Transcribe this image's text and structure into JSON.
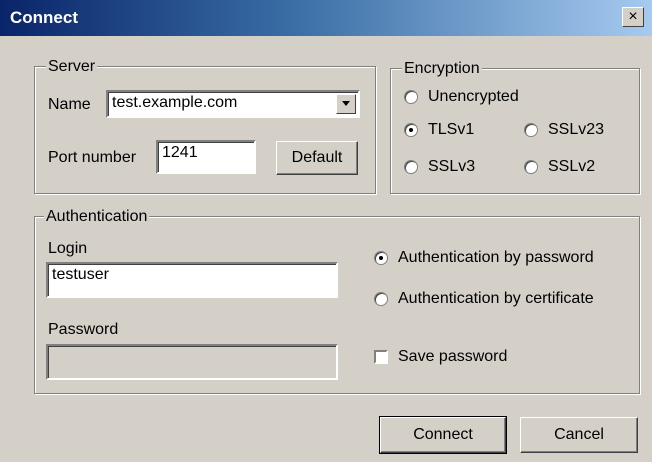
{
  "window": {
    "title": "Connect",
    "close_glyph": "×"
  },
  "server": {
    "legend": "Server",
    "name_label": "Name",
    "name_value": "test.example.com",
    "port_label": "Port number",
    "port_value": "1241",
    "default_button": "Default"
  },
  "encryption": {
    "legend": "Encryption",
    "options": [
      "Unencrypted",
      "TLSv1",
      "SSLv23",
      "SSLv3",
      "SSLv2"
    ],
    "selected": "TLSv1"
  },
  "authentication": {
    "legend": "Authentication",
    "login_label": "Login",
    "login_value": "testuser",
    "password_label": "Password",
    "password_value": "",
    "by_password": "Authentication by password",
    "by_certificate": "Authentication by certificate",
    "save_password": "Save password",
    "selected": "Authentication by password"
  },
  "buttons": {
    "connect": "Connect",
    "cancel": "Cancel"
  },
  "icons": {
    "dropdown": "chevron-down-icon",
    "close": "close-icon"
  }
}
